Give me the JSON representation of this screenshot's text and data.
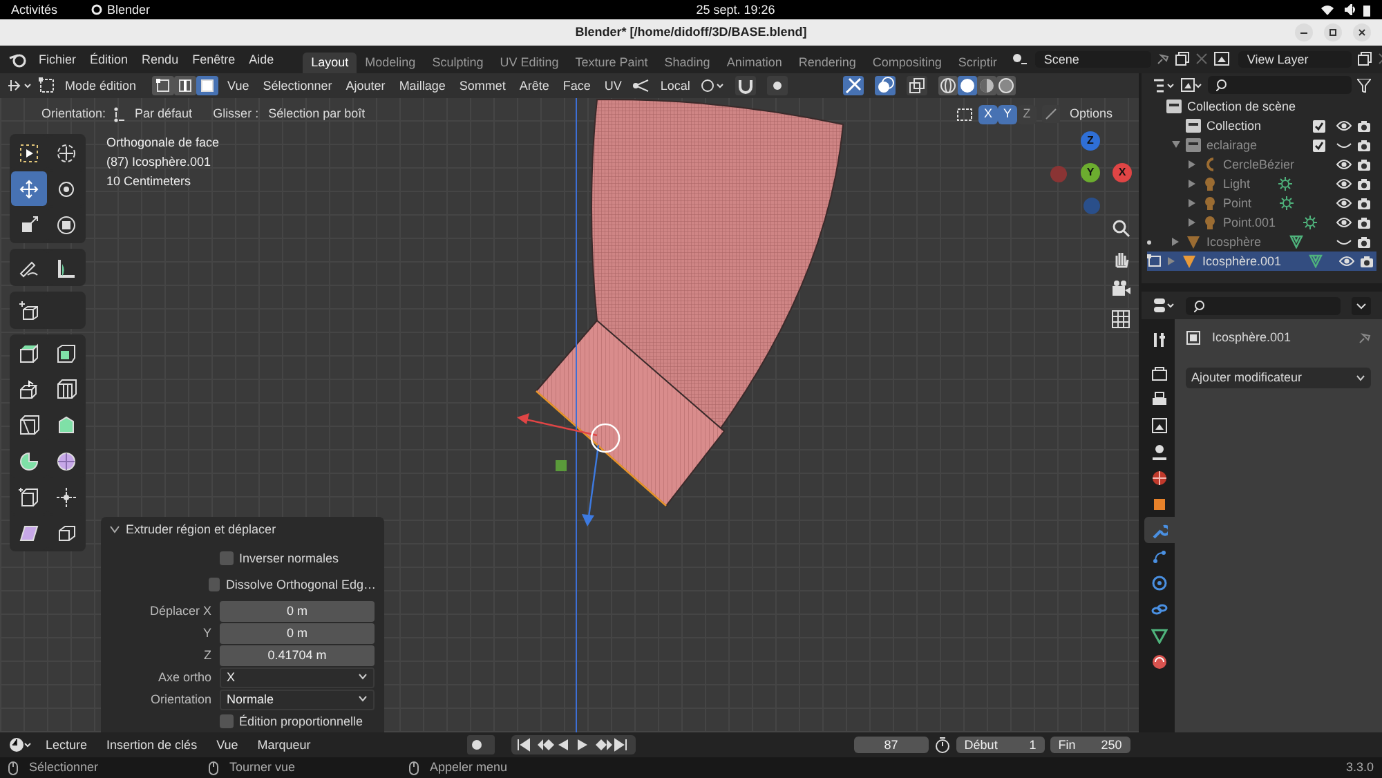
{
  "system_bar": {
    "activities": "Activités",
    "app": "Blender",
    "clock": "25 sept. 19:26"
  },
  "window": {
    "title": "Blender* [/home/didoff/3D/BASE.blend]"
  },
  "menus": [
    "Fichier",
    "Édition",
    "Rendu",
    "Fenêtre",
    "Aide"
  ],
  "workspaces": [
    {
      "label": "Layout",
      "selected": true
    },
    {
      "label": "Modeling",
      "selected": false
    },
    {
      "label": "Sculpting",
      "selected": false
    },
    {
      "label": "UV Editing",
      "selected": false
    },
    {
      "label": "Texture Paint",
      "selected": false
    },
    {
      "label": "Shading",
      "selected": false
    },
    {
      "label": "Animation",
      "selected": false
    },
    {
      "label": "Rendering",
      "selected": false
    },
    {
      "label": "Compositing",
      "selected": false
    },
    {
      "label": "Scriptir",
      "selected": false
    }
  ],
  "scene": "Scene",
  "view_layer": "View Layer",
  "viewport": {
    "mode": "Mode édition",
    "select_modes": [
      {
        "kind": "vertex",
        "selected": false
      },
      {
        "kind": "edge",
        "selected": false
      },
      {
        "kind": "face",
        "selected": true
      }
    ],
    "menus": [
      "Vue",
      "Sélectionner",
      "Ajouter",
      "Maillage",
      "Sommet",
      "Arête",
      "Face",
      "UV"
    ],
    "pivot": "Local",
    "toggles": [
      {
        "kind": "snap",
        "on": false
      },
      {
        "kind": "proportional",
        "on": false
      },
      {
        "kind": "gizmo",
        "on": true
      },
      {
        "kind": "overlay",
        "on": true
      },
      {
        "kind": "xray",
        "on": false
      }
    ],
    "shading": [
      {
        "kind": "wire",
        "selected": false
      },
      {
        "kind": "solid",
        "selected": true
      },
      {
        "kind": "material",
        "selected": false
      },
      {
        "kind": "rendered",
        "selected": false
      }
    ],
    "orientation_label": "Orientation:",
    "orientation": "Par défaut",
    "drag_label": "Glisser :",
    "drag": "Sélection par boît",
    "mirror_axes": [
      {
        "label": "X",
        "on": true
      },
      {
        "label": "Y",
        "on": true
      },
      {
        "label": "Z",
        "on": false
      }
    ],
    "options": "Options",
    "overlay_text": [
      "Orthogonale de face",
      "(87) Icosphère.001",
      "10 Centimeters"
    ],
    "tool_groups": [
      [
        {
          "kind": "select",
          "selected": false
        },
        {
          "kind": "cursor",
          "selected": false
        },
        {
          "kind": "move",
          "selected": true
        },
        {
          "kind": "rotate",
          "selected": false
        },
        {
          "kind": "scale",
          "selected": false
        },
        {
          "kind": "transform",
          "selected": false
        }
      ],
      [
        {
          "kind": "annotate",
          "selected": false
        },
        {
          "kind": "measure",
          "selected": false
        }
      ],
      [
        {
          "kind": "add-cube",
          "selected": false
        }
      ],
      [
        {
          "kind": "extrude",
          "selected": false
        },
        {
          "kind": "inset",
          "selected": false
        },
        {
          "kind": "extrude-arrow",
          "selected": false
        },
        {
          "kind": "loopcut",
          "selected": false
        },
        {
          "kind": "knife",
          "selected": false
        },
        {
          "kind": "polybuild",
          "selected": false
        },
        {
          "kind": "spin",
          "selected": false
        },
        {
          "kind": "smooth",
          "selected": false
        },
        {
          "kind": "add-edge",
          "selected": false
        },
        {
          "kind": "slide",
          "selected": false
        },
        {
          "kind": "shear",
          "selected": false
        },
        {
          "kind": "rip",
          "selected": false
        }
      ]
    ],
    "gizmo_axes": [
      "Z",
      "Y",
      "X"
    ],
    "operator_panel": {
      "title": "Extruder région et déplacer",
      "expanded": true,
      "rows": [
        {
          "kind": "checkbox",
          "text": "Inverser normales",
          "checked": false
        },
        {
          "kind": "checkbox",
          "text": "Dissolve Orthogonal Edg…",
          "checked": false
        },
        {
          "kind": "number",
          "label": "Déplacer X",
          "value": "0 m"
        },
        {
          "kind": "number",
          "label": "Y",
          "value": "0 m"
        },
        {
          "kind": "number",
          "label": "Z",
          "value": "0.41704 m"
        },
        {
          "kind": "dropdown",
          "label": "Axe ortho",
          "value": "X"
        },
        {
          "kind": "dropdown",
          "label": "Orientation",
          "value": "Normale"
        },
        {
          "kind": "checkbox",
          "text": "Édition proportionnelle",
          "checked": false
        }
      ]
    }
  },
  "outliner": {
    "root": "Collection de scène",
    "items": [
      {
        "name": "Collection",
        "kind": "collection",
        "checked": true,
        "visible": true,
        "selected": false
      },
      {
        "name": "eclairage",
        "kind": "collection",
        "checked": true,
        "visible": false,
        "selected": false,
        "expanded": true,
        "children": [
          {
            "name": "CercleBézier",
            "kind": "curve",
            "visible": true,
            "selected": false,
            "expanded": false
          },
          {
            "name": "Light",
            "kind": "light",
            "visible": true,
            "selected": false,
            "expanded": false
          },
          {
            "name": "Point",
            "kind": "light",
            "visible": true,
            "selected": false,
            "expanded": false
          },
          {
            "name": "Point.001",
            "kind": "light",
            "visible": true,
            "selected": false,
            "expanded": false
          }
        ]
      },
      {
        "name": "Icosphère",
        "kind": "mesh",
        "visible": false,
        "selected": false,
        "expanded": false
      },
      {
        "name": "Icosphère.001",
        "kind": "mesh",
        "visible": true,
        "selected": true,
        "expanded": false
      }
    ]
  },
  "properties": {
    "object": "Icosphère.001",
    "add_modifier": "Ajouter modificateur",
    "tabs": [
      {
        "kind": "tool",
        "selected": false
      },
      {
        "kind": "render",
        "selected": false
      },
      {
        "kind": "output",
        "selected": false
      },
      {
        "kind": "view",
        "selected": false
      },
      {
        "kind": "scene",
        "selected": false
      },
      {
        "kind": "world",
        "selected": false
      },
      {
        "kind": "object",
        "selected": false
      },
      {
        "kind": "modifier",
        "selected": true
      },
      {
        "kind": "particles",
        "selected": false
      },
      {
        "kind": "physics",
        "selected": false
      },
      {
        "kind": "constraints",
        "selected": false
      },
      {
        "kind": "data",
        "selected": false
      },
      {
        "kind": "material",
        "selected": false
      }
    ]
  },
  "timeline": {
    "menus": [
      "Lecture",
      "Insertion de clés",
      "Vue",
      "Marqueur"
    ],
    "frame": "87",
    "start_label": "Début",
    "start": "1",
    "end_label": "Fin",
    "end": "250"
  },
  "status_bar": {
    "hints": [
      "Sélectionner",
      "Tourner vue",
      "Appeler menu"
    ],
    "version": "3.3.0"
  }
}
